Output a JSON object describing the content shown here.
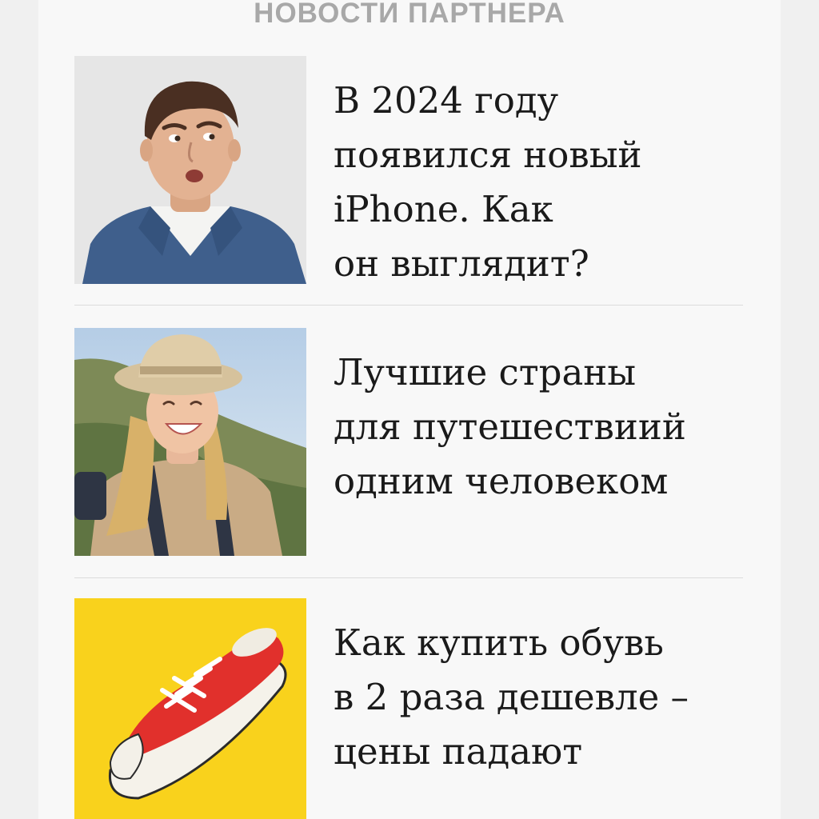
{
  "section": {
    "title": "НОВОСТИ ПАРТНЕРА"
  },
  "articles": [
    {
      "headline": "В 2024 году\nпоявился новый\niPhone. Как\nон выглядит?",
      "image": "surprised-man-photo"
    },
    {
      "headline": "Лучшие страны\nдля путешествиий\nодним человеком",
      "image": "smiling-traveler-woman-photo"
    },
    {
      "headline": "Как купить обувь\nв 2 раза дешевле –\nцены падают",
      "image": "red-sneaker-photo"
    }
  ],
  "colors": {
    "page_background": "#f0f0f0",
    "panel_background": "#f8f8f8",
    "section_title": "#a8a8a8",
    "headline_text": "#1a1a1a",
    "divider": "#dcdcdc",
    "sneaker_background": "#f9d21c",
    "sneaker_red": "#e1302c"
  }
}
